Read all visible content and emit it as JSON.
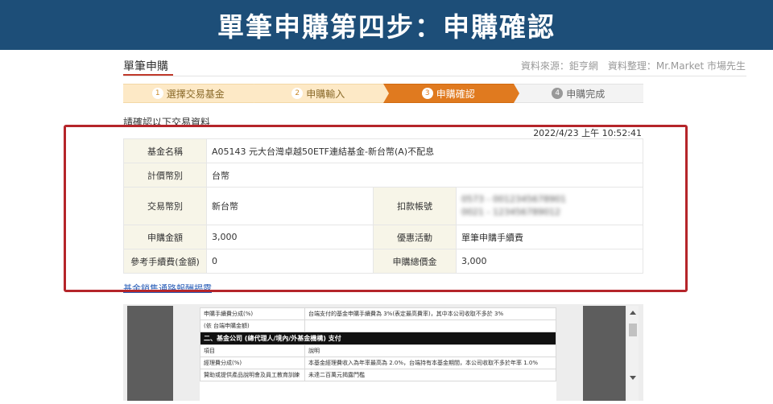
{
  "banner": {
    "title": "單筆申購第四步：申購確認",
    "bg_color": "#1d4e78"
  },
  "header": {
    "heading": "單筆申購",
    "source": "資料來源：鉅亨網　資料整理：Mr.Market 市場先生"
  },
  "stepper": {
    "steps": [
      {
        "num": "1",
        "label": "選擇交易基金",
        "state": "done"
      },
      {
        "num": "2",
        "label": "申購輸入",
        "state": "done"
      },
      {
        "num": "3",
        "label": "申購確認",
        "state": "active"
      },
      {
        "num": "4",
        "label": "申購完成",
        "state": "pending"
      }
    ],
    "accent_color": "#e07a1f"
  },
  "confirm": {
    "title": "請確認以下交易資料",
    "timestamp": "2022/4/23 上午 10:52:41"
  },
  "table": {
    "fund_name_label": "基金名稱",
    "fund_name_value": "A05143 元大台灣卓越50ETF連結基金-新台幣(A)不配息",
    "currency_label": "計價幣別",
    "currency_value": "台幣",
    "trade_currency_label": "交易幣別",
    "trade_currency_value": "新台幣",
    "debit_account_label": "扣款帳號",
    "debit_account_line1": "0573 - 0012345678901",
    "debit_account_line2": "0021 - 123456789012",
    "amount_label": "申購金額",
    "amount_value": "3,000",
    "promo_label": "優惠活動",
    "promo_value": "單筆申購手續費",
    "fee_label": "參考手續費(金額)",
    "fee_value": "0",
    "total_label": "申購總價金",
    "total_value": "3,000"
  },
  "link": {
    "label": "基金銷售通路報酬揭露"
  },
  "doc": {
    "row1_c1": "申購手續費分成(%)",
    "row1_c2": "台端支付的基金申購手續費為 3%(表定最高費率)，其中本公司收取不多於 3%",
    "row2_c1": "(依 台端申購金額)",
    "row2_c2": "",
    "section": "二、基金公司 (總代理人/境內/外基金機構) 支付",
    "row3_c1": "項目",
    "row3_c2": "說明",
    "row4_c1": "經理費分成(%)",
    "row4_c2": "本基金經理費收入為年率最高為 2.0%，台端持有本基金期間，本公司收取不多於年率 1.0%",
    "row5_c1": "贊助或提供產品說明會及員工教育訓練",
    "row5_c2": "未達二百萬元揭露門檻"
  },
  "highlight_color": "#b5252a"
}
